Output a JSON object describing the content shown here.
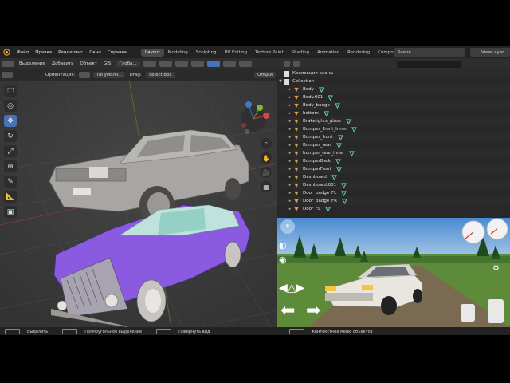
{
  "topbar": {
    "menu": [
      "Файл",
      "Правка",
      "Рендеринг",
      "Окно",
      "Справка"
    ],
    "workspaces": [
      "Layout",
      "Modeling",
      "Sculpting",
      "UV Editing",
      "Texture Paint",
      "Shading",
      "Animation",
      "Rendering",
      "Compositing",
      "Ge"
    ],
    "active_workspace": "Layout",
    "scene": "Scene",
    "view_layer": "ViewLayer"
  },
  "viewport_header": {
    "select_label": "Выделение",
    "add_label": "Добавить",
    "object_label": "Объект",
    "gis_label": "GIS",
    "transform_orientation": "Глоба...",
    "orientation_label": "Ориентация:",
    "orientation_value": "По умолч...",
    "drag_label": "Drag:",
    "drag_value": "Select Box",
    "options_label": "Опции"
  },
  "outliner": {
    "title": "Коллекция сцены",
    "collection": "Collection",
    "items": [
      "Body",
      "Body.001",
      "Body_badge",
      "bottom",
      "Brakelights_glass",
      "Bumper_Front_Inner",
      "Bumper_front",
      "Bumper_rear",
      "bumper_rear_inner",
      "BumperBack",
      "BumperFront",
      "Dashboard",
      "Dashboard.001",
      "Door_badge_FL",
      "Door_badge_FR",
      "Door_FL"
    ]
  },
  "statusbar": {
    "select": "Выделить",
    "box_select": "Прямоугольное выделение",
    "rotate_view": "Повернуть вид",
    "context_menu": "Контекстное меню объектов"
  },
  "colors": {
    "accent": "#4772b3",
    "car_top": "#a8a6a2",
    "car_bottom": "#8a5ae0",
    "car_roof": "#bfe3dc",
    "grid_bg": "#3d3d3d"
  }
}
